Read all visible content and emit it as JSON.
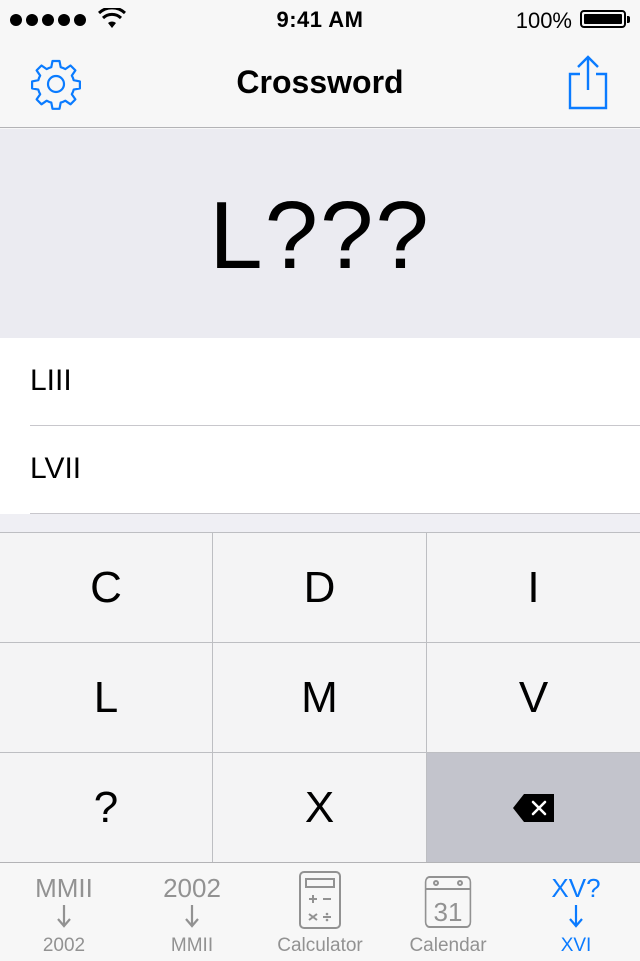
{
  "status_bar": {
    "time": "9:41 AM",
    "battery": "100%"
  },
  "nav": {
    "title": "Crossword",
    "left_icon": "gear-icon",
    "right_icon": "share-icon"
  },
  "display": {
    "pattern": "L???"
  },
  "results": [
    {
      "text": "LIII"
    },
    {
      "text": "LVII"
    }
  ],
  "keypad": {
    "keys": [
      "C",
      "D",
      "I",
      "L",
      "M",
      "V",
      "?",
      "X"
    ],
    "delete_icon": "backspace-icon"
  },
  "tabs": [
    {
      "top": "MMII",
      "label": "2002",
      "icon": "arrow-down-icon"
    },
    {
      "top": "2002",
      "label": "MMII",
      "icon": "arrow-down-icon"
    },
    {
      "top": "",
      "label": "Calculator",
      "icon": "calculator-icon"
    },
    {
      "top": "",
      "label": "Calendar",
      "icon": "calendar-icon",
      "icon_text": "31"
    },
    {
      "top": "XV?",
      "label": "XVI",
      "icon": "arrow-down-icon",
      "active": true
    }
  ],
  "colors": {
    "accent": "#0a7bff",
    "inactive": "#929292",
    "display_bg": "#ebebf1",
    "key_bg": "#f4f4f5",
    "delete_key_bg": "#c3c4cc"
  }
}
